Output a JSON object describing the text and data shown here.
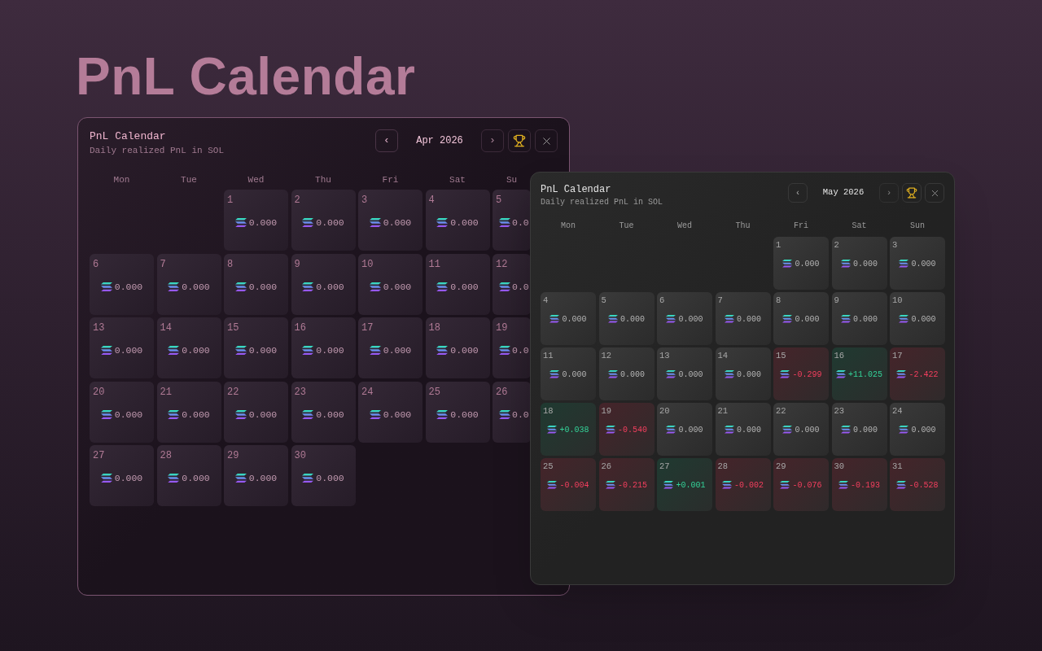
{
  "heading": "PnL Calendar",
  "windows": [
    {
      "title": "PnL Calendar",
      "subtitle": "Daily realized PnL in SOL",
      "prev": "‹",
      "month": "Apr 2026",
      "next": "›",
      "weekdays": [
        "Mon",
        "Tue",
        "Wed",
        "Thu",
        "Fri",
        "Sat",
        "Su"
      ],
      "weeks": [
        [
          {
            "kind": "blank"
          },
          {
            "kind": "blank"
          },
          {
            "kind": "zero",
            "day": "1",
            "value": "0.000"
          },
          {
            "kind": "zero",
            "day": "2",
            "value": "0.000"
          },
          {
            "kind": "zero",
            "day": "3",
            "value": "0.000"
          },
          {
            "kind": "zero",
            "day": "4",
            "value": "0.000"
          },
          {
            "kind": "zero",
            "day": "5",
            "value": "0.0"
          }
        ],
        [
          {
            "kind": "zero",
            "day": "6",
            "value": "0.000"
          },
          {
            "kind": "zero",
            "day": "7",
            "value": "0.000"
          },
          {
            "kind": "zero",
            "day": "8",
            "value": "0.000"
          },
          {
            "kind": "zero",
            "day": "9",
            "value": "0.000"
          },
          {
            "kind": "zero",
            "day": "10",
            "value": "0.000"
          },
          {
            "kind": "zero",
            "day": "11",
            "value": "0.000"
          },
          {
            "kind": "zero",
            "day": "12",
            "value": "0.0"
          }
        ],
        [
          {
            "kind": "zero",
            "day": "13",
            "value": "0.000"
          },
          {
            "kind": "zero",
            "day": "14",
            "value": "0.000"
          },
          {
            "kind": "zero",
            "day": "15",
            "value": "0.000"
          },
          {
            "kind": "zero",
            "day": "16",
            "value": "0.000"
          },
          {
            "kind": "zero",
            "day": "17",
            "value": "0.000"
          },
          {
            "kind": "zero",
            "day": "18",
            "value": "0.000"
          },
          {
            "kind": "zero",
            "day": "19",
            "value": "0.0"
          }
        ],
        [
          {
            "kind": "zero",
            "day": "20",
            "value": "0.000"
          },
          {
            "kind": "zero",
            "day": "21",
            "value": "0.000"
          },
          {
            "kind": "zero",
            "day": "22",
            "value": "0.000"
          },
          {
            "kind": "zero",
            "day": "23",
            "value": "0.000"
          },
          {
            "kind": "zero",
            "day": "24",
            "value": "0.000"
          },
          {
            "kind": "zero",
            "day": "25",
            "value": "0.000"
          },
          {
            "kind": "zero",
            "day": "26",
            "value": "0.0"
          }
        ],
        [
          {
            "kind": "zero",
            "day": "27",
            "value": "0.000"
          },
          {
            "kind": "zero",
            "day": "28",
            "value": "0.000"
          },
          {
            "kind": "zero",
            "day": "29",
            "value": "0.000"
          },
          {
            "kind": "zero",
            "day": "30",
            "value": "0.000"
          },
          {
            "kind": "blank"
          },
          {
            "kind": "blank"
          },
          {
            "kind": "blank"
          }
        ]
      ]
    },
    {
      "title": "PnL Calendar",
      "subtitle": "Daily realized PnL in SOL",
      "prev": "‹",
      "month": "May 2026",
      "next": "›",
      "weekdays": [
        "Mon",
        "Tue",
        "Wed",
        "Thu",
        "Fri",
        "Sat",
        "Sun"
      ],
      "weeks": [
        [
          {
            "kind": "blank"
          },
          {
            "kind": "blank"
          },
          {
            "kind": "blank"
          },
          {
            "kind": "blank"
          },
          {
            "kind": "zero",
            "day": "1",
            "value": "0.000"
          },
          {
            "kind": "zero",
            "day": "2",
            "value": "0.000"
          },
          {
            "kind": "zero",
            "day": "3",
            "value": "0.000"
          }
        ],
        [
          {
            "kind": "zero",
            "day": "4",
            "value": "0.000"
          },
          {
            "kind": "zero",
            "day": "5",
            "value": "0.000"
          },
          {
            "kind": "zero",
            "day": "6",
            "value": "0.000"
          },
          {
            "kind": "zero",
            "day": "7",
            "value": "0.000"
          },
          {
            "kind": "zero",
            "day": "8",
            "value": "0.000"
          },
          {
            "kind": "zero",
            "day": "9",
            "value": "0.000"
          },
          {
            "kind": "zero",
            "day": "10",
            "value": "0.000"
          }
        ],
        [
          {
            "kind": "zero",
            "day": "11",
            "value": "0.000"
          },
          {
            "kind": "zero",
            "day": "12",
            "value": "0.000"
          },
          {
            "kind": "zero",
            "day": "13",
            "value": "0.000"
          },
          {
            "kind": "zero",
            "day": "14",
            "value": "0.000"
          },
          {
            "kind": "loss",
            "day": "15",
            "value": "-0.299"
          },
          {
            "kind": "gain",
            "day": "16",
            "value": "+11.025"
          },
          {
            "kind": "loss",
            "day": "17",
            "value": "-2.422"
          }
        ],
        [
          {
            "kind": "gain",
            "day": "18",
            "value": "+0.038"
          },
          {
            "kind": "loss",
            "day": "19",
            "value": "-0.540"
          },
          {
            "kind": "zero",
            "day": "20",
            "value": "0.000"
          },
          {
            "kind": "zero",
            "day": "21",
            "value": "0.000"
          },
          {
            "kind": "zero",
            "day": "22",
            "value": "0.000"
          },
          {
            "kind": "zero",
            "day": "23",
            "value": "0.000"
          },
          {
            "kind": "zero",
            "day": "24",
            "value": "0.000"
          }
        ],
        [
          {
            "kind": "loss",
            "day": "25",
            "value": "-0.004"
          },
          {
            "kind": "loss",
            "day": "26",
            "value": "-0.215"
          },
          {
            "kind": "gain",
            "day": "27",
            "value": "+0.001"
          },
          {
            "kind": "loss",
            "day": "28",
            "value": "-0.002"
          },
          {
            "kind": "loss",
            "day": "29",
            "value": "-0.076"
          },
          {
            "kind": "loss",
            "day": "30",
            "value": "-0.193"
          },
          {
            "kind": "loss",
            "day": "31",
            "value": "-0.528"
          }
        ]
      ]
    }
  ]
}
